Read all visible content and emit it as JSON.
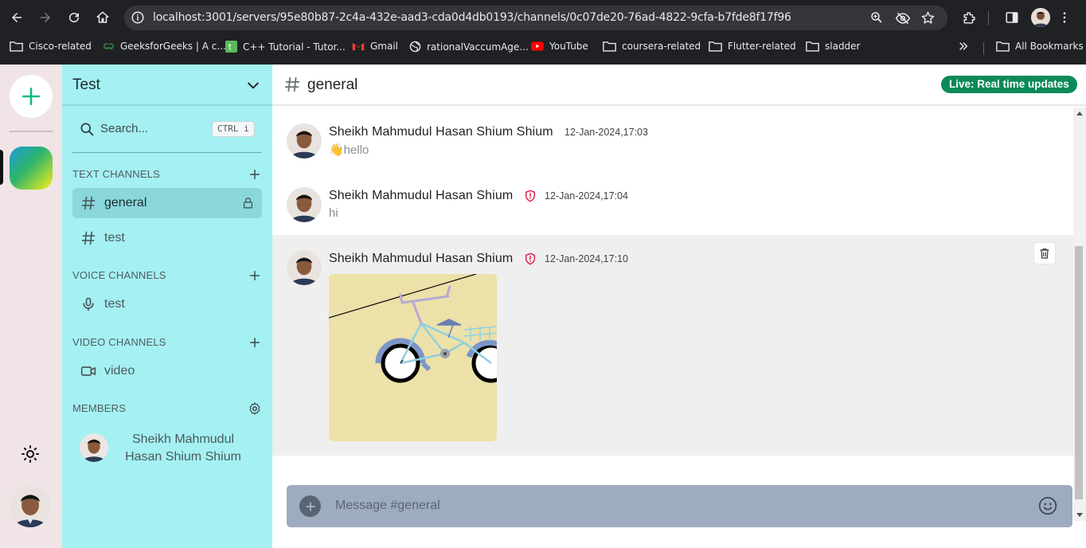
{
  "browser": {
    "url": "localhost:3001/servers/95e80b87-2c4a-432e-aad3-cda0d4db0193/channels/0c07de20-76ad-4822-9cfa-b7fde8f17f96",
    "bookmarks": [
      {
        "label": "Cisco-related",
        "icon": "folder-icon"
      },
      {
        "label": "GeeksforGeeks | A c...",
        "icon": "gfg-icon"
      },
      {
        "label": "C++ Tutorial - Tutor...",
        "icon": "cpp-icon"
      },
      {
        "label": "Gmail",
        "icon": "gmail-icon"
      },
      {
        "label": "rationalVaccumAge...",
        "icon": "globe-icon"
      },
      {
        "label": "YouTube",
        "icon": "youtube-icon"
      },
      {
        "label": "coursera-related",
        "icon": "folder-icon"
      },
      {
        "label": "Flutter-related",
        "icon": "folder-icon"
      },
      {
        "label": "sladder",
        "icon": "folder-icon"
      }
    ],
    "all_bookmarks": "All Bookmarks"
  },
  "server": {
    "name": "Test",
    "search_label": "Search...",
    "search_shortcut": "CTRL",
    "search_shortcut_key": "i"
  },
  "sections": {
    "text": "TEXT CHANNELS",
    "voice": "VOICE CHANNELS",
    "video": "VIDEO CHANNELS",
    "members": "MEMBERS"
  },
  "channels": {
    "text": [
      {
        "label": "general",
        "active": true,
        "locked": true
      },
      {
        "label": "test",
        "active": false,
        "locked": false
      }
    ],
    "voice": [
      {
        "label": "test"
      }
    ],
    "video": [
      {
        "label": "video"
      }
    ]
  },
  "members": [
    {
      "name": "Sheikh Mahmudul Hasan Shium Shium"
    }
  ],
  "chat": {
    "channel": "general",
    "live_badge": "Live: Real time updates",
    "placeholder": "Message #general"
  },
  "messages": [
    {
      "author": "Sheikh Mahmudul Hasan Shium Shium",
      "time": "12-Jan-2024,17:03",
      "text": "👋hello",
      "role_badge": false
    },
    {
      "author": "Sheikh Mahmudul Hasan Shium",
      "time": "12-Jan-2024,17:04",
      "text": "hi",
      "role_badge": true
    },
    {
      "author": "Sheikh Mahmudul Hasan Shium",
      "time": "12-Jan-2024,17:10",
      "text": "",
      "role_badge": true,
      "attachment": "bicycle-image"
    }
  ],
  "colors": {
    "rail_bg": "#f0e4e6",
    "sidebar_bg": "#a5f0f2",
    "active_channel": "#8ad8db",
    "live_badge": "#0c8a5a",
    "composer_bg": "#9eacbf",
    "admin_badge": "#e11d48",
    "accent_green": "#10b981"
  }
}
